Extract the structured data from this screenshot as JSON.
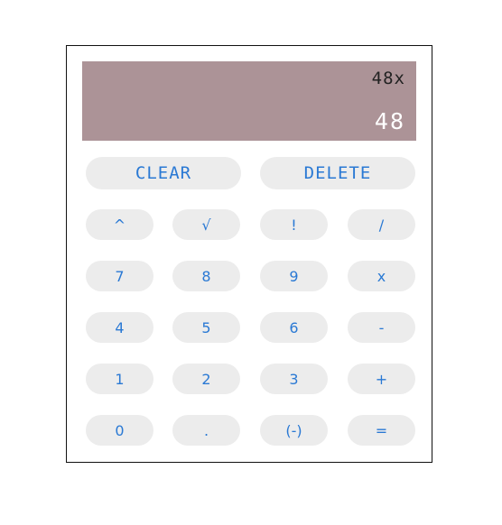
{
  "display": {
    "expression": "48x",
    "result": "48"
  },
  "actions": {
    "clear": "CLEAR",
    "delete": "DELETE"
  },
  "keys": [
    [
      "^",
      "√",
      "!",
      "/"
    ],
    [
      "7",
      "8",
      "9",
      "x"
    ],
    [
      "4",
      "5",
      "6",
      "-"
    ],
    [
      "1",
      "2",
      "3",
      "+"
    ],
    [
      "0",
      ".",
      "(-)",
      "="
    ]
  ],
  "colors": {
    "display_bg": "#ac9397",
    "button_bg": "#ececec",
    "key_text": "#2a79d4"
  }
}
